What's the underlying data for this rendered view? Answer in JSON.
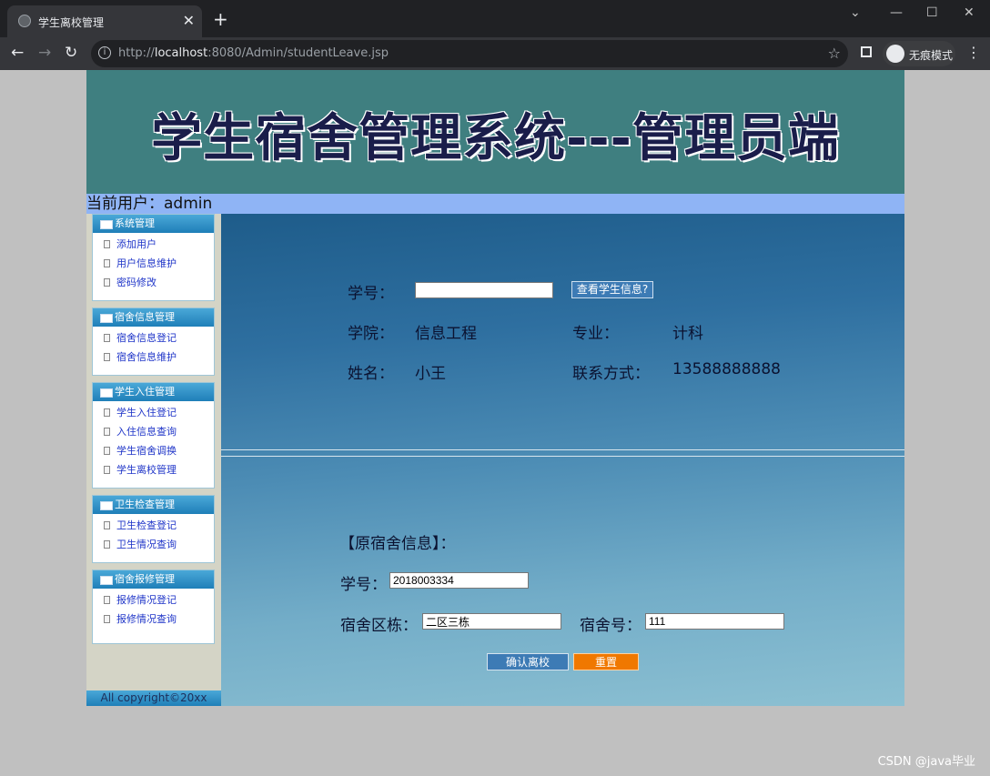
{
  "browser": {
    "tab_title": "学生离校管理",
    "new_tab": "+",
    "url_prefix": "http://",
    "url_host": "localhost",
    "url_rest": ":8080/Admin/studentLeave.jsp",
    "profile_label": "无痕模式"
  },
  "header": {
    "title": "学生宿舍管理系统---管理员端",
    "current_user": "当前用户：admin"
  },
  "sidebar": {
    "groups": [
      {
        "title": "系统管理",
        "items": [
          "添加用户",
          "用户信息维护",
          "密码修改"
        ]
      },
      {
        "title": "宿舍信息管理",
        "items": [
          "宿舍信息登记",
          "宿舍信息维护"
        ]
      },
      {
        "title": "学生入住管理",
        "items": [
          "学生入住登记",
          "入住信息查询",
          "学生宿舍调换",
          "学生离校管理"
        ]
      },
      {
        "title": "卫生检查管理",
        "items": [
          "卫生检查登记",
          "卫生情况查询"
        ]
      },
      {
        "title": "宿舍报修管理",
        "items": [
          "报修情况登记",
          "报修情况查询"
        ]
      }
    ],
    "footer": "All copyright©20xx"
  },
  "student": {
    "id_label": "学号：",
    "id_value": "",
    "query_button": "查看学生信息?",
    "college_label": "学院：",
    "college_value": "信息工程",
    "major_label": "专业：",
    "major_value": "计科",
    "name_label": "姓名：",
    "name_value": "小王",
    "contact_label": "联系方式：",
    "contact_value": "13588888888"
  },
  "dorm": {
    "section_title": "【原宿舍信息】：",
    "id_label": "学号：",
    "id_value": "2018003334",
    "building_label": "宿舍区栋：",
    "building_value": "二区三栋",
    "room_label": "宿舍号：",
    "room_value": "111",
    "confirm_button": "确认离校",
    "reset_button": "重置"
  },
  "watermark": "CSDN @java毕业",
  "colors": {
    "banner": "#3f7f80",
    "userbar": "#8fb4f5",
    "confirm": "#3d7bb5",
    "reset": "#f07800"
  }
}
